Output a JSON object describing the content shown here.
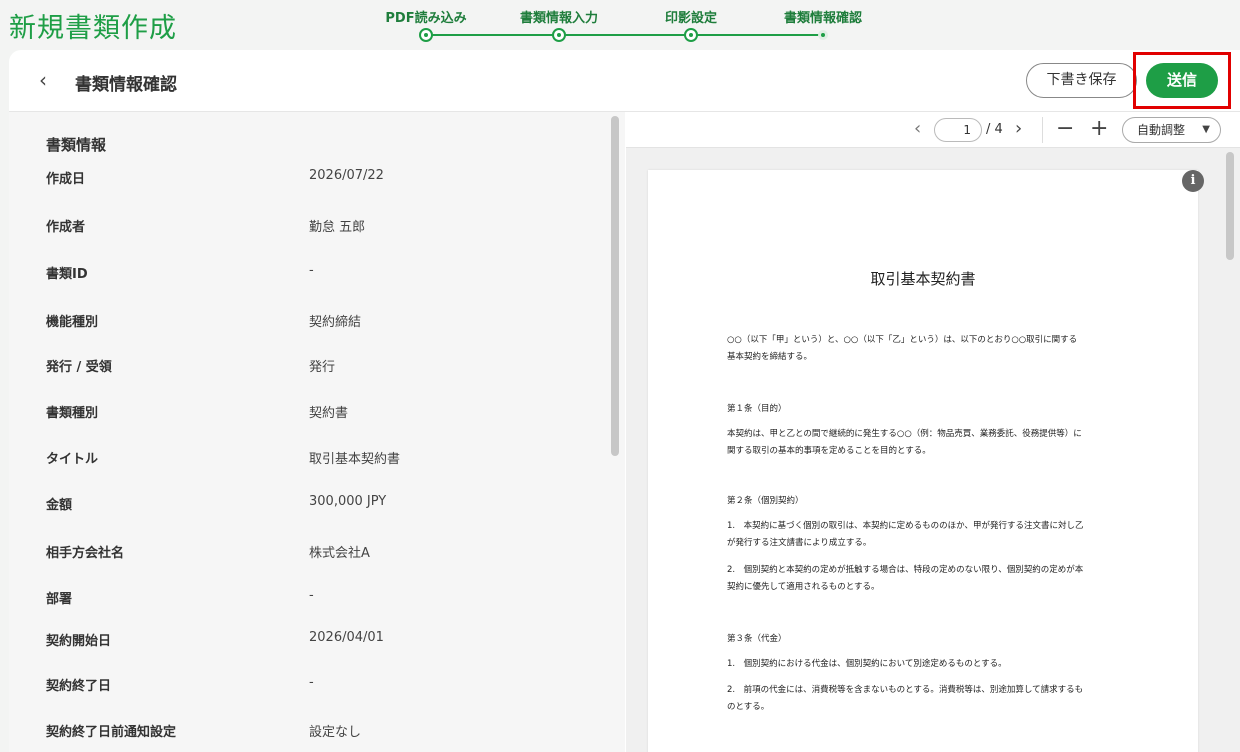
{
  "app": {
    "title": "新規書類作成"
  },
  "stepper": {
    "steps": [
      {
        "label": "PDF読み込み"
      },
      {
        "label": "書類情報入力"
      },
      {
        "label": "印影設定"
      },
      {
        "label": "書類情報確認"
      }
    ],
    "current_step": 4
  },
  "header": {
    "back_icon": "‹",
    "title": "書類情報確認",
    "draft_label": "下書き保存",
    "send_label": "送信"
  },
  "info": {
    "section_title": "書類情報",
    "rows": [
      {
        "label": "作成日",
        "value": "2026/07/22"
      },
      {
        "label": "作成者",
        "value": "勤怠 五郎"
      },
      {
        "label": "書類ID",
        "value": "-"
      },
      {
        "label": "機能種別",
        "value": "契約締結"
      },
      {
        "label": "発行 / 受領",
        "value": "発行"
      },
      {
        "label": "書類種別",
        "value": "契約書"
      },
      {
        "label": "タイトル",
        "value": "取引基本契約書"
      },
      {
        "label": "金額",
        "value": "300,000 JPY"
      },
      {
        "label": "相手方会社名",
        "value": "株式会社A"
      },
      {
        "label": "部署",
        "value": "-"
      },
      {
        "label": "契約開始日",
        "value": "2026/04/01"
      },
      {
        "label": "契約終了日",
        "value": "-"
      },
      {
        "label": "契約終了日前通知設定",
        "value": "設定なし"
      }
    ]
  },
  "viewer": {
    "prev_icon": "‹",
    "next_icon": "›",
    "current_page": "1",
    "total_pages": "/ 4",
    "zoom_out_icon": "−",
    "zoom_in_icon": "+",
    "zoom_mode": "自動調整",
    "caret_icon": "▼",
    "info_icon": "i"
  },
  "document": {
    "title": "取引基本契約書",
    "intro_1": "○○（以下「甲」という）と、○○（以下「乙」という）は、以下のとおり○○取引に関する",
    "intro_2": "基本契約を締結する。",
    "art1_heading": "第１条（目的）",
    "art1_1": "本契約は、甲と乙との間で継続的に発生する○○（例：物品売買、業務委託、役務提供等）に",
    "art1_2": "関する取引の基本的事項を定めることを目的とする。",
    "art2_heading": "第２条（個別契約）",
    "art2_p1_1": "1.　本契約に基づく個別の取引は、本契約に定めるもののほか、甲が発行する注文書に対し乙",
    "art2_p1_2": "が発行する注文請書により成立する。",
    "art2_p2_1": "2.　個別契約と本契約の定めが抵触する場合は、特段の定めのない限り、個別契約の定めが本",
    "art2_p2_2": "契約に優先して適用されるものとする。",
    "art3_heading": "第３条（代金）",
    "art3_p1": "1.　個別契約における代金は、個別契約において別途定めるものとする。",
    "art3_p2_1": "2.　前項の代金には、消費税等を含まないものとする。消費税等は、別途加算して請求するも",
    "art3_p2_2": "のとする。"
  },
  "colors": {
    "brand_green": "#1e9e46",
    "highlight_red": "#e10000"
  }
}
